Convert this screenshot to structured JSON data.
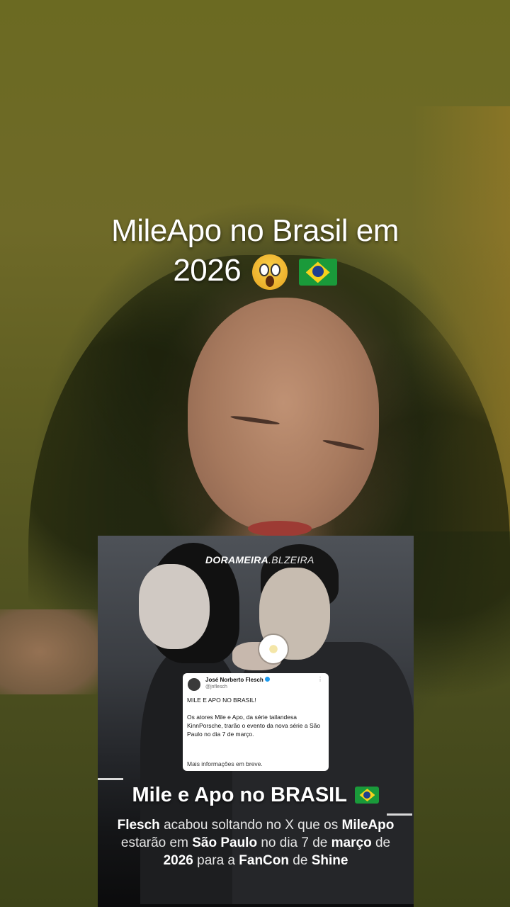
{
  "caption": {
    "line1": "MileApo no Brasil em",
    "line2": "2026",
    "emojis": [
      "face-screaming-icon",
      "brazil-flag-icon"
    ]
  },
  "card": {
    "watermark_bold": "DORAMEIRA",
    "watermark_rest": ".BLZEIRA",
    "tweet": {
      "name": "José Norberto Flesch",
      "handle": "@jnflesch",
      "headline": "MILE E APO NO BRASIL!",
      "body": "Os atores Mile e Apo, da série tailandesa KinnPorsche, trarão o evento da nova série a São Paulo no dia 7 de março.",
      "footer": "Mais informações em breve."
    },
    "headline": "Mile e Apo no BRASIL",
    "desc": {
      "p1": "Flesch",
      "p2": " acabou soltando no X que os ",
      "p3": "MileApo",
      "p4": " estarão em ",
      "p5": "São Paulo",
      "p6": " no dia 7 de ",
      "p7": "março",
      "p8": " de ",
      "p9": "2026",
      "p10": " para a ",
      "p11": "FanCon",
      "p12": " de ",
      "p13": "Shine"
    }
  },
  "colors": {
    "caption_text": "#ffffff",
    "tweet_verified": "#1d9bf0",
    "flag_green": "#1a9a3a",
    "flag_yellow": "#f7d21c",
    "flag_blue": "#1f3f8f"
  }
}
